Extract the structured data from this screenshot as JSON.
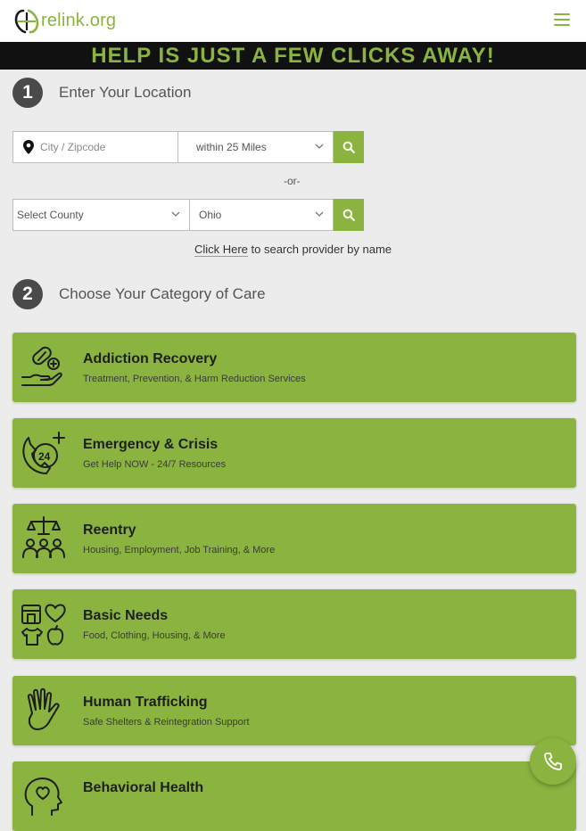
{
  "header": {
    "logo_text": "relink.org",
    "menu_icon": "hamburger-icon"
  },
  "banner": {
    "text": "HELP IS JUST A FEW CLICKS AWAY!"
  },
  "step1": {
    "number": "1",
    "title": "Enter Your Location",
    "city_placeholder": "City / Zipcode",
    "radius_value": "within 25 Miles",
    "or_text": "-or-",
    "county_value": "Select County",
    "state_value": "Ohio",
    "click_link": "Click Here",
    "click_rest": " to search provider by name"
  },
  "step2": {
    "number": "2",
    "title": "Choose Your Category of Care"
  },
  "categories": [
    {
      "title": "Addiction Recovery",
      "subtitle": "Treatment, Prevention, & Harm Reduction Services",
      "icon": "pill-hand-icon"
    },
    {
      "title": "Emergency & Crisis",
      "subtitle": "Get Help NOW - 24/7 Resources",
      "icon": "24-hour-phone-icon"
    },
    {
      "title": "Reentry",
      "subtitle": "Housing, Employment, Job Training, & More",
      "icon": "scales-people-icon"
    },
    {
      "title": "Basic Needs",
      "subtitle": "Food, Clothing, Housing, & More",
      "icon": "basic-needs-icon"
    },
    {
      "title": "Human Trafficking",
      "subtitle": "Safe Shelters & Reintegration Support",
      "icon": "raised-hand-icon"
    },
    {
      "title": "Behavioral Health",
      "subtitle": "",
      "icon": "head-heart-icon"
    }
  ],
  "colors": {
    "accent": "#8ab43f",
    "banner_bg": "#111111",
    "page_bg": "#ececec"
  }
}
